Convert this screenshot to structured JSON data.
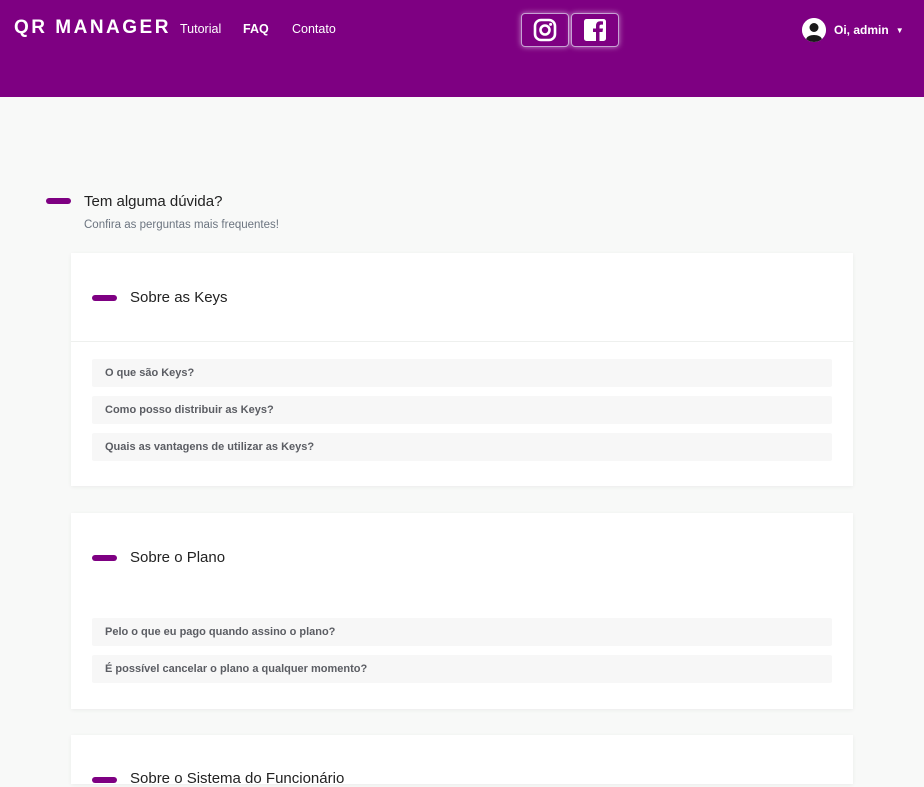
{
  "header": {
    "brand": "QR MANAGER",
    "nav": [
      {
        "label": "Tutorial",
        "active": false
      },
      {
        "label": "FAQ",
        "active": true
      },
      {
        "label": "Contato",
        "active": false
      }
    ],
    "social": [
      "instagram-icon",
      "facebook-icon"
    ],
    "user": {
      "greeting": "Oi, admin",
      "caret": "▼"
    },
    "background": "#7e0082"
  },
  "faq": {
    "title": "Tem alguma dúvida?",
    "subtitle": "Confira as perguntas mais frequentes!",
    "sections": [
      {
        "title": "Sobre as Keys",
        "questions": [
          "O que são Keys?",
          "Como posso distribuir as Keys?",
          "Quais as vantagens de utilizar as Keys?"
        ]
      },
      {
        "title": "Sobre o Plano",
        "questions": [
          "Pelo o que eu pago quando assino o plano?",
          "É possível cancelar o plano a qualquer momento?"
        ]
      },
      {
        "title": "Sobre o Sistema do Funcionário",
        "questions": []
      }
    ]
  },
  "colors": {
    "accent": "#7e0082",
    "page_bg": "#f8f9f8",
    "card_bg": "#ffffff"
  }
}
